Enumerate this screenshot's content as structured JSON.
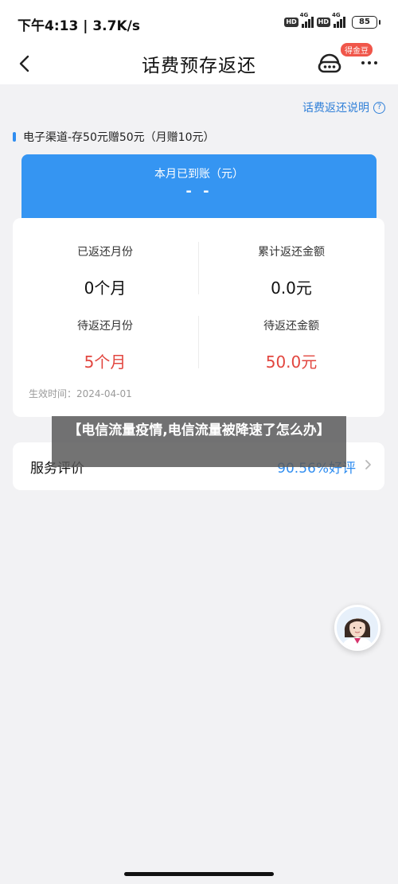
{
  "status_bar": {
    "time": "下午4:13 | 3.7K/s",
    "hd1": "HD",
    "net1": "4G",
    "hd2": "HD",
    "net2": "4G",
    "battery": "85"
  },
  "nav": {
    "title": "话费预存返还",
    "badge": "得金豆"
  },
  "explain_link": "话费返还说明",
  "channel": "电子渠道-存50元赠50元（月赠10元）",
  "summary": {
    "label": "本月已到账（元）",
    "value": "- -"
  },
  "stats": {
    "returned_months_label": "已返还月份",
    "returned_months_value": "0个月",
    "returned_total_label": "累计返还金额",
    "returned_total_value": "0.0元",
    "pending_months_label": "待返还月份",
    "pending_months_value": "5个月",
    "pending_amount_label": "待返还金额",
    "pending_amount_value": "50.0元",
    "effective_date": "生效时间：2024-04-01"
  },
  "rating": {
    "label": "服务评价",
    "value": "90.56%好评"
  },
  "caption": "【电信流量疫情,电信流量被降速了怎么办】",
  "colors": {
    "accent": "#3595f2",
    "link": "#2f7fd8",
    "alert": "#e2463f",
    "background": "#f2f2f4"
  }
}
